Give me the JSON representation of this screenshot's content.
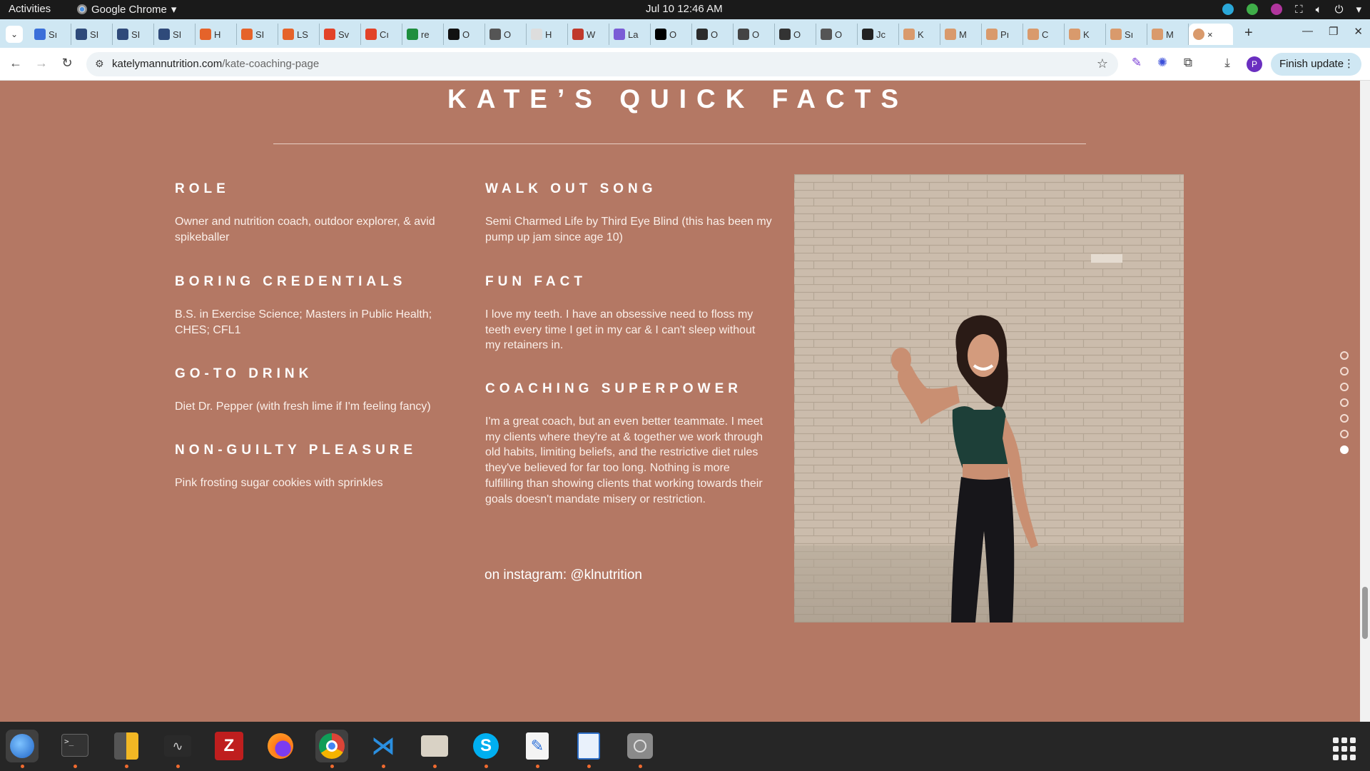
{
  "system": {
    "activities": "Activities",
    "app_name": "Google Chrome",
    "clock": "Jul 10  12:46 AM"
  },
  "browser": {
    "tabs": [
      {
        "label": "Sı",
        "color": "#3b6fd9"
      },
      {
        "label": "SI",
        "color": "#2f4a7a"
      },
      {
        "label": "SI",
        "color": "#2f4a7a"
      },
      {
        "label": "SI",
        "color": "#2f4a7a"
      },
      {
        "label": "H",
        "color": "#e5632a"
      },
      {
        "label": "SI",
        "color": "#e5632a"
      },
      {
        "label": "LS",
        "color": "#e5632a"
      },
      {
        "label": "Sv",
        "color": "#e24329"
      },
      {
        "label": "Cı",
        "color": "#e24329"
      },
      {
        "label": "re",
        "color": "#1e8e3e"
      },
      {
        "label": "O",
        "color": "#111111"
      },
      {
        "label": "O",
        "color": "#555555"
      },
      {
        "label": "H",
        "color": "#dddddd"
      },
      {
        "label": "W",
        "color": "#c0392b"
      },
      {
        "label": "La",
        "color": "#7a5cd6"
      },
      {
        "label": "O",
        "color": "#000000"
      },
      {
        "label": "O",
        "color": "#2b2b2b"
      },
      {
        "label": "O",
        "color": "#444444"
      },
      {
        "label": "O",
        "color": "#333333"
      },
      {
        "label": "O",
        "color": "#555555"
      },
      {
        "label": "Jc",
        "color": "#222222"
      },
      {
        "label": "K",
        "color": "#d99a6c"
      },
      {
        "label": "M",
        "color": "#d99a6c"
      },
      {
        "label": "Pı",
        "color": "#d99a6c"
      },
      {
        "label": "C",
        "color": "#d99a6c"
      },
      {
        "label": "K",
        "color": "#d99a6c"
      },
      {
        "label": "Sı",
        "color": "#d99a6c"
      },
      {
        "label": "M",
        "color": "#d99a6c"
      }
    ],
    "active_tab_close": "×",
    "url_host": "katelymannutrition.com",
    "url_path": "/kate-coaching-page",
    "finish_update": "Finish update",
    "profile_initial": "P"
  },
  "page": {
    "title": "KATE’S QUICK FACTS",
    "facts_left": [
      {
        "heading": "ROLE",
        "text": "Owner and nutrition coach, outdoor explorer, & avid spikeballer"
      },
      {
        "heading": "BORING CREDENTIALS",
        "text": "B.S. in Exercise Science; Masters in Public Health; CHES; CFL1"
      },
      {
        "heading": "GO-TO DRINK",
        "text": "Diet Dr. Pepper (with fresh lime if I'm feeling fancy)"
      },
      {
        "heading": "NON-GUILTY PLEASURE",
        "text": "Pink frosting sugar cookies with sprinkles"
      }
    ],
    "facts_right": [
      {
        "heading": "WALK OUT SONG",
        "text": "Semi Charmed Life by Third Eye Blind (this has been my pump up jam since age 10)"
      },
      {
        "heading": "FUN FACT",
        "text": "I love my teeth. I have an obsessive need to floss my teeth every time I get in my car & I can't sleep without my retainers in."
      },
      {
        "heading": "COACHING SUPERPOWER",
        "text": "I'm a great coach, but an even better teammate. I meet my clients where they're at & together we work through old habits, limiting beliefs, and the restrictive diet rules they've believed for far too long. Nothing is more fulfilling than showing clients that working towards their goals doesn't mandate misery or restriction."
      }
    ],
    "instagram": "on instagram: @klnutrition",
    "section_dots_total": 7,
    "section_dot_active": 6
  }
}
